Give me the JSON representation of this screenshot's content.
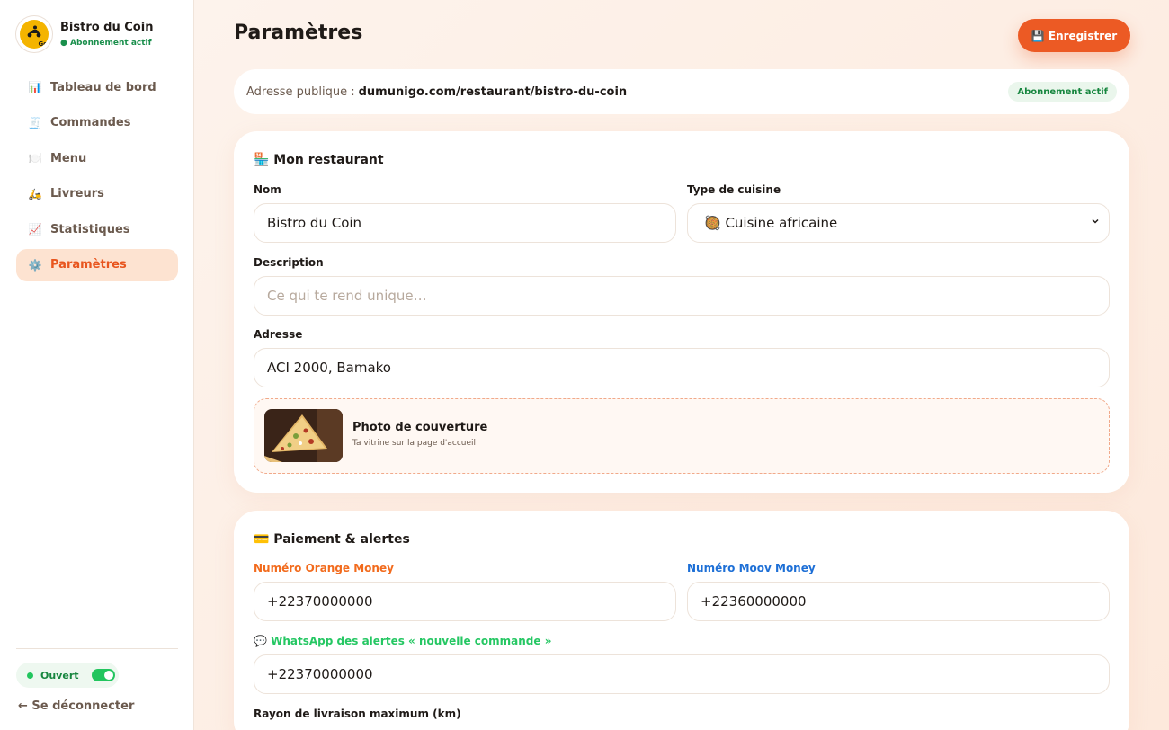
{
  "sidebar": {
    "brand_name": "Bistro du Coin",
    "brand_status": "● Abonnement actif",
    "logo_text": "Go",
    "items": [
      {
        "label": "Tableau de bord",
        "icon": "📊"
      },
      {
        "label": "Commandes",
        "icon": "🧾"
      },
      {
        "label": "Menu",
        "icon": "🍽️"
      },
      {
        "label": "Livreurs",
        "icon": "🛵"
      },
      {
        "label": "Statistiques",
        "icon": "📈"
      },
      {
        "label": "Paramètres",
        "icon": "⚙️"
      }
    ],
    "open_status": "Ouvert",
    "logout_label": "← Se déconnecter"
  },
  "header": {
    "title": "Paramètres",
    "save_label": "💾 Enregistrer"
  },
  "url_bar": {
    "label": "Adresse publique :",
    "value": "dumunigo.com/restaurant/bistro-du-coin",
    "badge": "Abonnement actif"
  },
  "restaurant": {
    "section_title": "🏪 Mon restaurant",
    "name_label": "Nom",
    "name_value": "Bistro du Coin",
    "cuisine_label": "Type de cuisine",
    "cuisine_value": "🥘 Cuisine africaine",
    "description_label": "Description",
    "description_placeholder": "Ce qui te rend unique…",
    "address_label": "Adresse",
    "address_value": "ACI 2000, Bamako",
    "cover_title": "Photo de couverture",
    "cover_subtitle": "Ta vitrine sur la page d'accueil"
  },
  "payment": {
    "section_title": "💳 Paiement & alertes",
    "orange_label": "Numéro Orange Money",
    "orange_value": "+22370000000",
    "moov_label": "Numéro Moov Money",
    "moov_value": "+22360000000",
    "whatsapp_label": "💬 WhatsApp des alertes « nouvelle commande »",
    "whatsapp_value": "+22370000000",
    "radius_label": "Rayon de livraison maximum (km)"
  },
  "colors": {
    "accent": "#ec5a24",
    "orange_money": "#f26b1d",
    "moov_money": "#1d6fd6",
    "whatsapp": "#25c763",
    "success": "#17863f"
  }
}
